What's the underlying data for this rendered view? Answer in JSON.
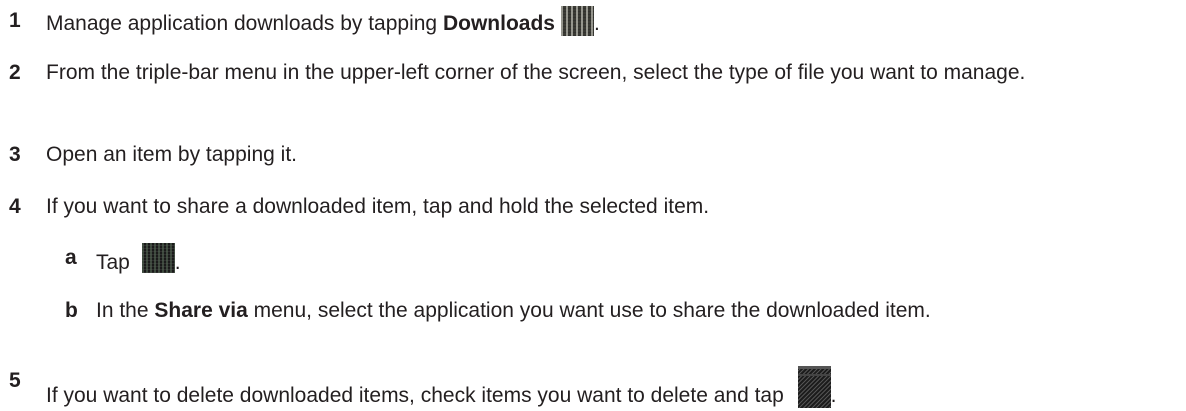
{
  "steps": [
    {
      "num": "1",
      "text_before": "Manage application downloads by tapping ",
      "bold": "Downloads",
      "text_after": ".",
      "icon": "downloads-icon"
    },
    {
      "num": "2",
      "text": "From the triple-bar menu in the upper-left corner of the screen, select the type of file you want to manage."
    },
    {
      "num": "3",
      "text": "Open an item by tapping it."
    },
    {
      "num": "4",
      "text": "If you want to share a downloaded item, tap and hold the selected item.",
      "substeps": [
        {
          "num": "a",
          "text_before": "Tap ",
          "text_after": ".",
          "icon": "share-icon"
        },
        {
          "num": "b",
          "text_before": "In the ",
          "bold": "Share via",
          "text_after": " menu, select the application you want use to share the downloaded item."
        }
      ]
    },
    {
      "num": "5",
      "text_before": "If you want to delete downloaded items, check items you want to delete and tap ",
      "text_after": ".",
      "icon": "delete-icon"
    }
  ]
}
